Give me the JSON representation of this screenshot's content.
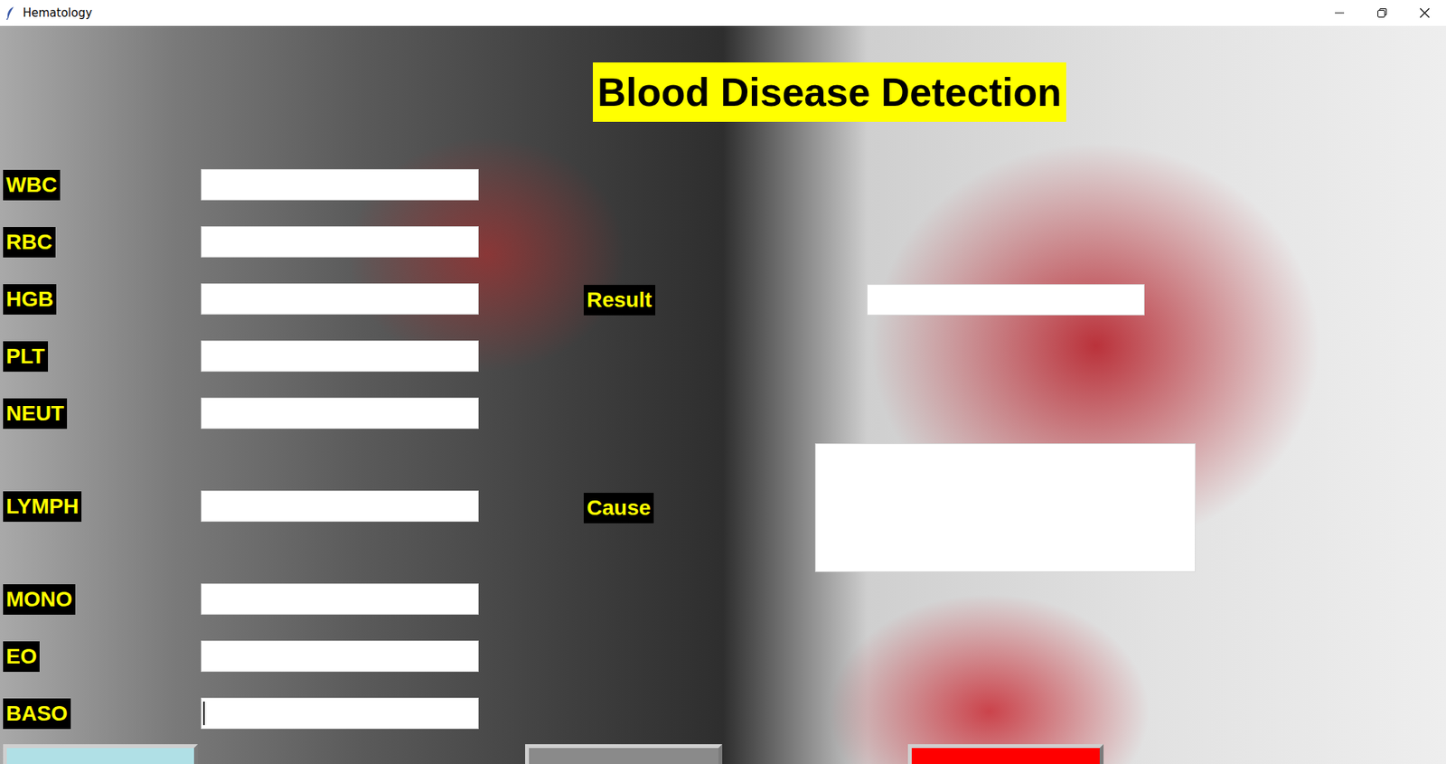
{
  "window": {
    "title": "Hematology"
  },
  "title": "Blood Disease Detection",
  "fields": [
    {
      "label": "WBC",
      "value": "",
      "focused": false
    },
    {
      "label": "RBC",
      "value": "",
      "focused": false
    },
    {
      "label": "HGB",
      "value": "",
      "focused": false
    },
    {
      "label": "PLT",
      "value": "",
      "focused": false
    },
    {
      "label": "NEUT",
      "value": "",
      "focused": false
    },
    {
      "label": "LYMPH",
      "value": "",
      "focused": false
    },
    {
      "label": "MONO",
      "value": "",
      "focused": false
    },
    {
      "label": "EO",
      "value": "",
      "focused": false
    },
    {
      "label": "BASO",
      "value": "",
      "focused": true
    }
  ],
  "result": {
    "label": "Result",
    "value": ""
  },
  "cause": {
    "label": "Cause",
    "value": ""
  },
  "buttons": [
    {
      "name": "left",
      "color": "#b0e0e6"
    },
    {
      "name": "middle",
      "color": "#8a8a8a"
    },
    {
      "name": "right",
      "color": "#ff0000"
    }
  ]
}
